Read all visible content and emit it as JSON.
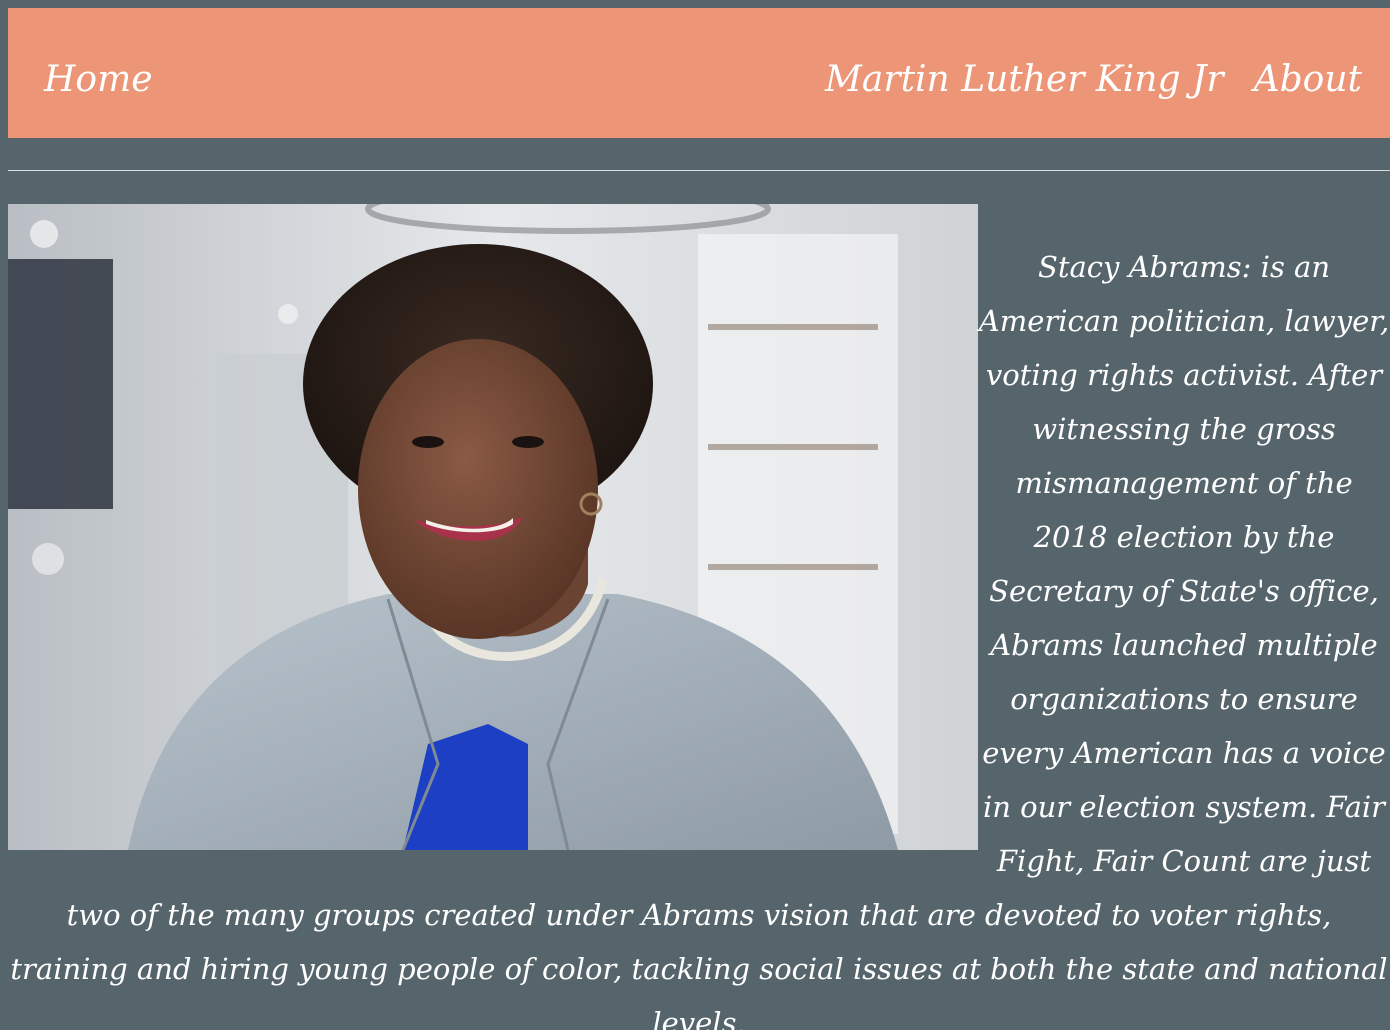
{
  "nav": {
    "home_label": "Home",
    "mlk_label": "Martin Luther King Jr",
    "about_label": "About"
  },
  "colors": {
    "navbar_background": "#ec9677",
    "page_background": "#56656b",
    "text": "#ffffff",
    "divider": "#d9dfe1"
  },
  "main": {
    "bio_text": "Stacy Abrams: is an American politician, lawyer, voting rights activist. After witnessing the gross mismanagement of the 2018 election by the Secretary of State's office, Abrams launched multiple organizations to ensure every American has a voice in our election system. Fair Fight, Fair Count are just two of the many groups created under Abrams vision that are devoted to voter rights, training and hiring young people of color, tackling social issues at both the state and national levels."
  }
}
